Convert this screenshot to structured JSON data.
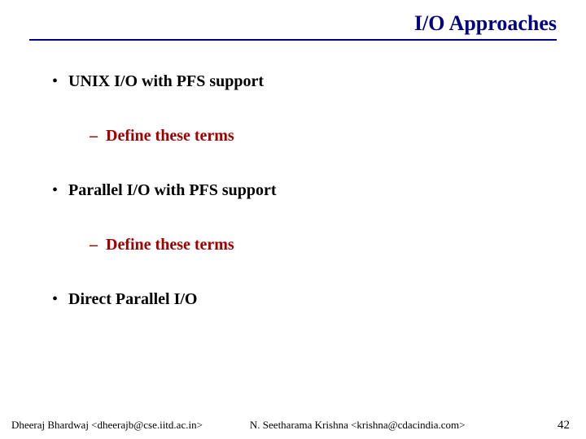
{
  "title": "I/O Approaches",
  "bullets": {
    "b1": "UNIX I/O with PFS support",
    "s1": "Define these terms",
    "b2": "Parallel I/O with PFS support",
    "s2": "Define these terms",
    "b3": "Direct Parallel I/O"
  },
  "footer": {
    "left": "Dheeraj Bhardwaj <dheerajb@cse.iitd.ac.in>",
    "mid": "N. Seetharama Krishna <krishna@cdacindia.com>",
    "page": "42"
  }
}
